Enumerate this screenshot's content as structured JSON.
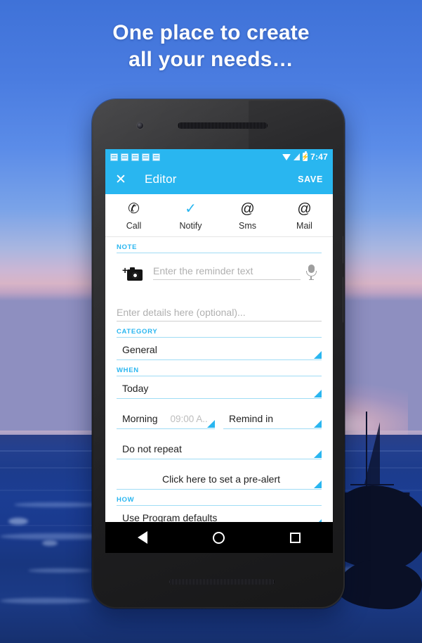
{
  "headline": {
    "line1": "One place to create",
    "line2": "all your needs…"
  },
  "colors": {
    "accent": "#29b6f0",
    "accent_rule": "#9fdcf5",
    "app_bar_text": "#ffffff",
    "placeholder": "#b0b0b0"
  },
  "phone": {
    "status_bar": {
      "notification_count": 5,
      "notification_icon": "note-icon",
      "wifi_icon": "wifi-icon",
      "signal_icon": "signal-icon",
      "battery_icon": "battery-charging-icon",
      "battery_glyph": "⚡",
      "time": "7:47"
    },
    "app_bar": {
      "close_icon": "close-icon",
      "close_glyph": "✕",
      "title": "Editor",
      "save_label": "SAVE"
    },
    "tabs": [
      {
        "label": "Call",
        "icon": "phone-icon",
        "glyph": "✆",
        "active": false
      },
      {
        "label": "Notify",
        "icon": "checkmark-icon",
        "glyph": "✓",
        "active": true
      },
      {
        "label": "Sms",
        "icon": "at-sign-icon",
        "glyph": "@",
        "active": false
      },
      {
        "label": "Mail",
        "icon": "at-sign-icon",
        "glyph": "@",
        "active": false
      }
    ],
    "sections": {
      "note": {
        "label": "NOTE",
        "camera_icon": "add-photo-icon",
        "reminder_placeholder": "Enter the reminder text",
        "reminder_value": "",
        "mic_icon": "microphone-icon",
        "details_placeholder": "Enter details here (optional)...",
        "details_value": ""
      },
      "category": {
        "label": "CATEGORY",
        "value": "General"
      },
      "when": {
        "label": "WHEN",
        "date_value": "Today",
        "time_of_day_value": "Morning",
        "time_hint": "09:00 A..",
        "remind_value": "Remind in",
        "repeat_value": "Do not repeat",
        "prealert_value": "Click here to set a pre-alert"
      },
      "how": {
        "label": "HOW",
        "value": "Use Program defaults"
      }
    },
    "nav_bar": {
      "back_icon": "back-triangle-icon",
      "home_icon": "home-circle-icon",
      "recents_icon": "recents-square-icon"
    }
  }
}
